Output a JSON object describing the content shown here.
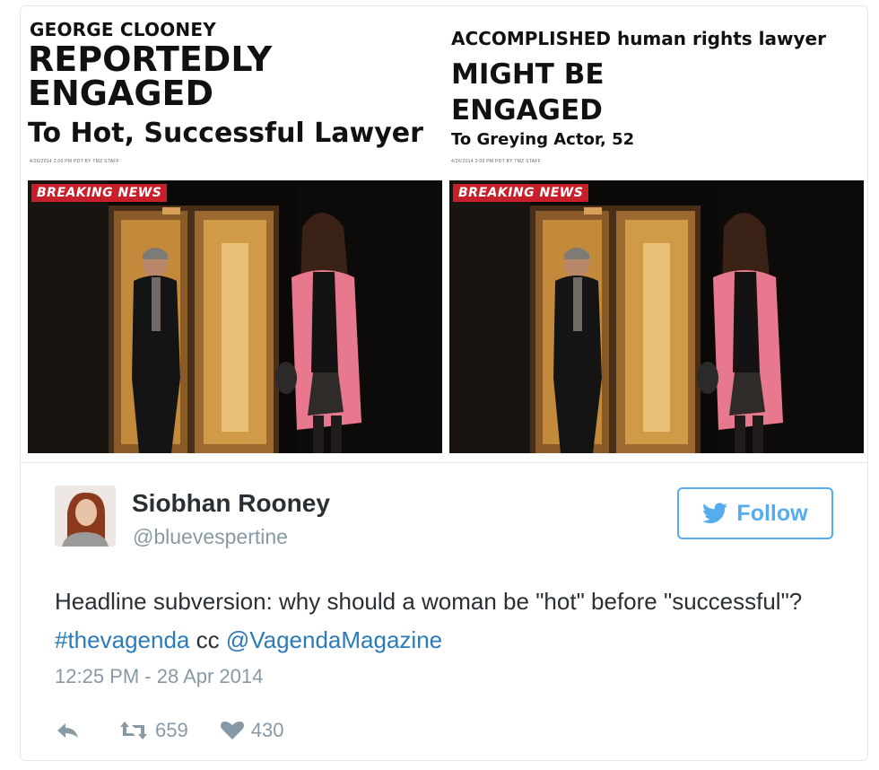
{
  "left_panel": {
    "headline_top": "GEORGE CLOONEY",
    "headline_main_1": "REPORTEDLY",
    "headline_main_2": "ENGAGED",
    "headline_sub": "To Hot, Successful Lawyer",
    "byline": "4/26/2014 2:00 PM PDT BY TMZ STAFF",
    "badge": "BREAKING NEWS"
  },
  "right_panel": {
    "headline_top": "ACCOMPLISHED human rights lawyer",
    "headline_main_1": "MIGHT BE",
    "headline_main_2": "ENGAGED",
    "headline_sub": "To Greying Actor, 52",
    "byline": "4/26/2014 2:00 PM PDT BY TMZ STAFF",
    "badge": "BREAKING NEWS"
  },
  "tweet": {
    "author_name": "Siobhan Rooney",
    "author_handle": "@bluevespertine",
    "follow_label": "Follow",
    "text_plain": "Headline subversion: why should a woman be \"hot\" before \"successful\"? ",
    "hashtag": "#thevagenda",
    "cc": " cc ",
    "mention": "@VagendaMagazine",
    "timestamp": "12:25 PM - 28 Apr 2014",
    "retweet_count": "659",
    "like_count": "430"
  },
  "colors": {
    "accent": "#55acee",
    "link": "#2b7bb9",
    "badge": "#c8202a",
    "coat": "#e8788e"
  },
  "icons": {
    "follow": "twitter-bird-icon",
    "reply": "reply-arrow-icon",
    "retweet": "retweet-icon",
    "like": "heart-icon"
  }
}
